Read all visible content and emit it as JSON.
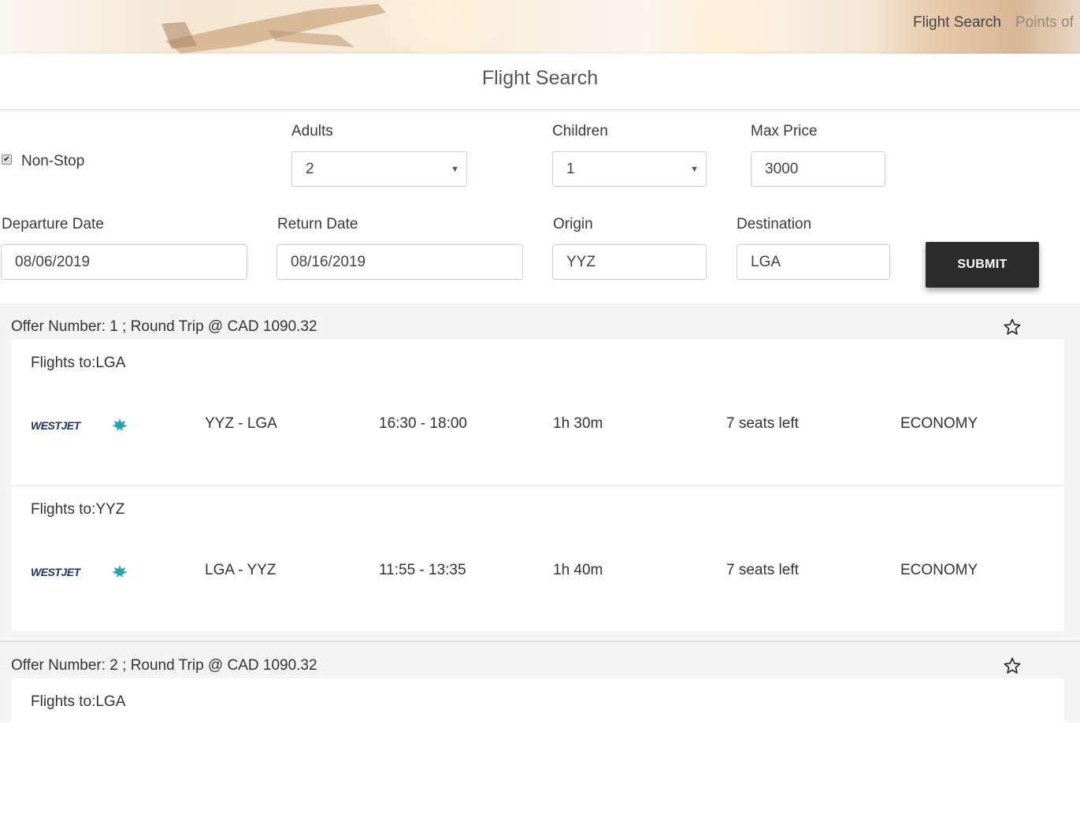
{
  "nav": {
    "items": [
      "Flight Search",
      "Points of"
    ]
  },
  "form": {
    "title": "Flight Search",
    "nonstop_label": "Non-Stop",
    "nonstop_checked": true,
    "adults": {
      "label": "Adults",
      "value": "2"
    },
    "children": {
      "label": "Children",
      "value": "1"
    },
    "max_price": {
      "label": "Max Price",
      "value": "3000"
    },
    "departure": {
      "label": "Departure Date",
      "value": "08/06/2019"
    },
    "return": {
      "label": "Return Date",
      "value": "08/16/2019"
    },
    "origin": {
      "label": "Origin",
      "value": "YYZ"
    },
    "destination": {
      "label": "Destination",
      "value": "LGA"
    },
    "submit_label": "SUBMIT"
  },
  "offers": [
    {
      "title": "Offer Number: 1 ; Round Trip @ CAD 1090.32",
      "legs": [
        {
          "title": "Flights to:LGA",
          "airline_logo": "WESTJET",
          "route": "YYZ - LGA",
          "times": "16:30 - 18:00",
          "duration": "1h 30m",
          "seats": "7 seats left",
          "cabin": "ECONOMY"
        },
        {
          "title": "Flights to:YYZ",
          "airline_logo": "WESTJET",
          "route": "LGA - YYZ",
          "times": "11:55 - 13:35",
          "duration": "1h 40m",
          "seats": "7 seats left",
          "cabin": "ECONOMY"
        }
      ]
    },
    {
      "title": "Offer Number: 2 ; Round Trip @ CAD 1090.32",
      "legs": [
        {
          "title": "Flights to:LGA"
        }
      ]
    }
  ],
  "colors": {
    "submit_bg": "#2b2b2b",
    "logo_navy": "#1f3563",
    "logo_teal": "#22a6b3"
  },
  "icons": [
    "star-outline-icon",
    "maple-leaf-icon",
    "chevron-down-icon",
    "checkmark-icon"
  ]
}
